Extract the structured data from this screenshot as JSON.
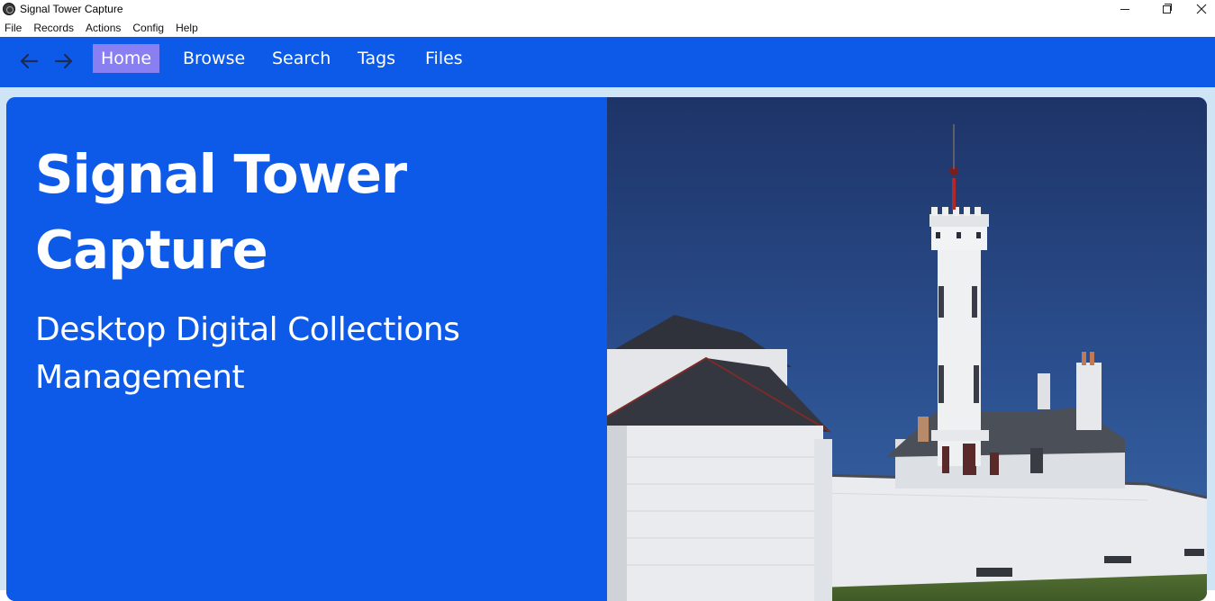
{
  "window": {
    "title": "Signal Tower Capture"
  },
  "menu": [
    "File",
    "Records",
    "Actions",
    "Config",
    "Help"
  ],
  "nav": {
    "back_icon": "arrow-left-icon",
    "forward_icon": "arrow-right-icon",
    "links": [
      "Home",
      "Browse",
      "Search",
      "Tags",
      "Files"
    ],
    "active": "Home"
  },
  "hero": {
    "title": "Signal Tower Capture",
    "subtitle": "Desktop Digital Collections Management",
    "image": "lighthouse-signal-tower-photo"
  },
  "colors": {
    "nav_bg": "#0d5ae8",
    "active_tab": "#8a7ff2",
    "content_bg": "#cfe4f4",
    "hero_bg": "#0d5ae8"
  }
}
